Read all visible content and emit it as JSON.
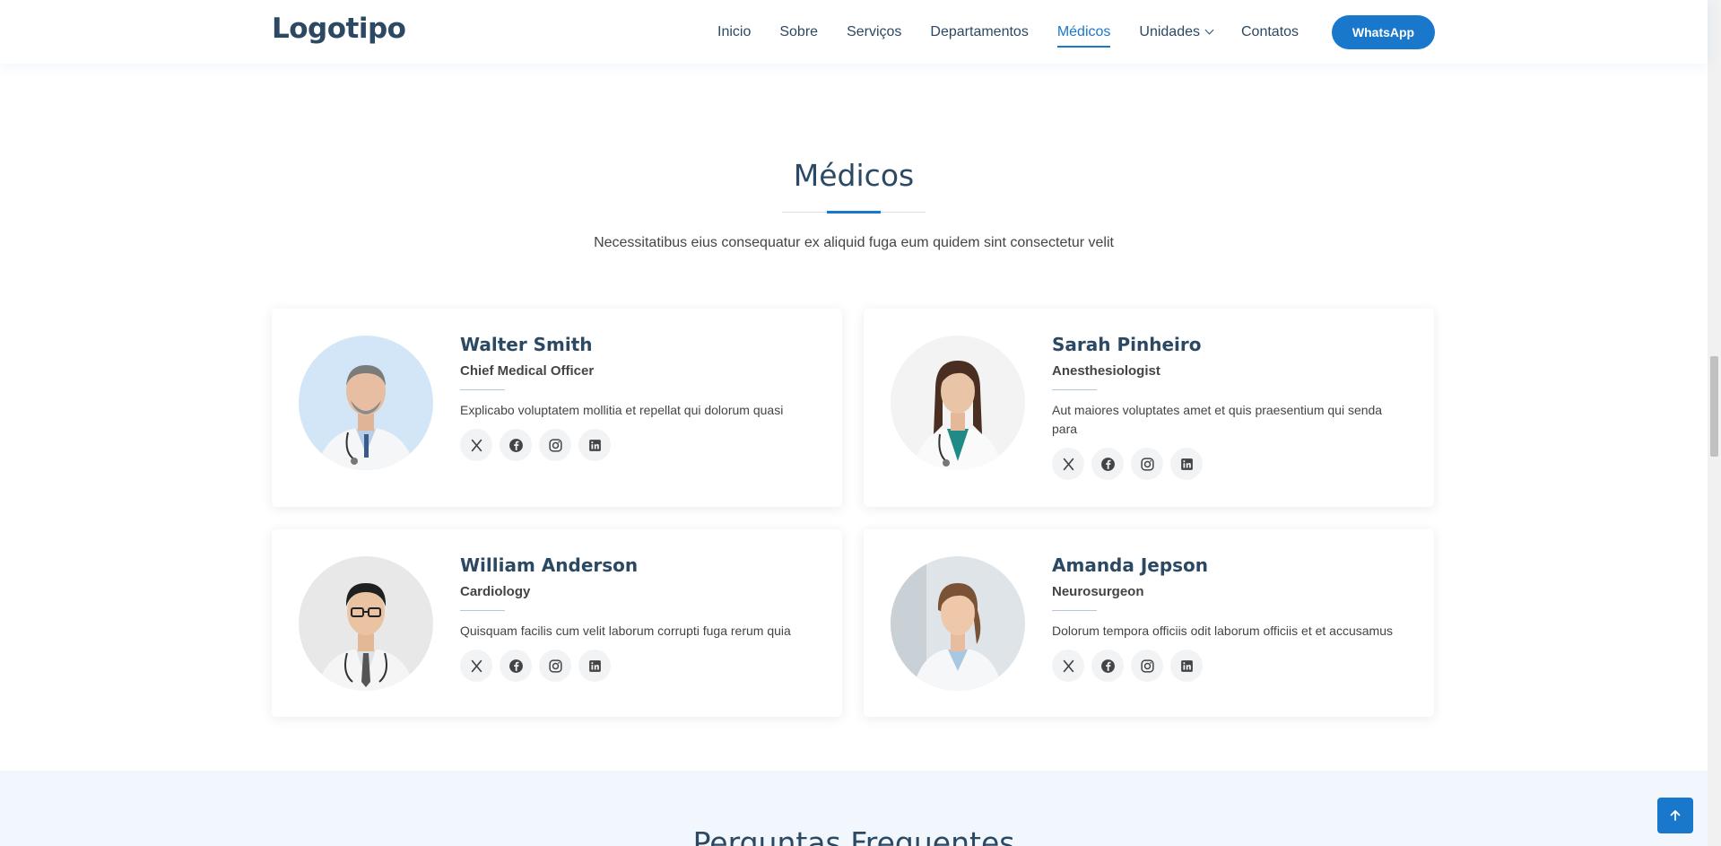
{
  "header": {
    "logo": "Logotipo",
    "nav": [
      {
        "label": "Inicio"
      },
      {
        "label": "Sobre"
      },
      {
        "label": "Serviços"
      },
      {
        "label": "Departamentos"
      },
      {
        "label": "Médicos",
        "active": true
      },
      {
        "label": "Unidades",
        "dropdown": true
      },
      {
        "label": "Contatos"
      }
    ],
    "cta_label": "WhatsApp"
  },
  "section": {
    "title": "Médicos",
    "description": "Necessitatibus eius consequatur ex aliquid fuga eum quidem sint consectetur velit"
  },
  "doctors": [
    {
      "name": "Walter Smith",
      "role": "Chief Medical Officer",
      "desc": "Explicabo voluptatem mollitia et repellat qui dolorum quasi"
    },
    {
      "name": "Sarah Pinheiro",
      "role": "Anesthesiologist",
      "desc": "Aut maiores voluptates amet et quis praesentium qui senda para"
    },
    {
      "name": "William Anderson",
      "role": "Cardiology",
      "desc": "Quisquam facilis cum velit laborum corrupti fuga rerum quia"
    },
    {
      "name": "Amanda Jepson",
      "role": "Neurosurgeon",
      "desc": "Dolorum tempora officiis odit laborum officiis et et accusamus"
    }
  ],
  "socials": [
    "x-icon",
    "facebook-icon",
    "instagram-icon",
    "linkedin-icon"
  ],
  "faq": {
    "title": "Perguntas Frequentes"
  },
  "colors": {
    "accent": "#1977cc",
    "heading": "#2c4964",
    "text": "#444444",
    "faq_bg": "#f1f7fd"
  }
}
